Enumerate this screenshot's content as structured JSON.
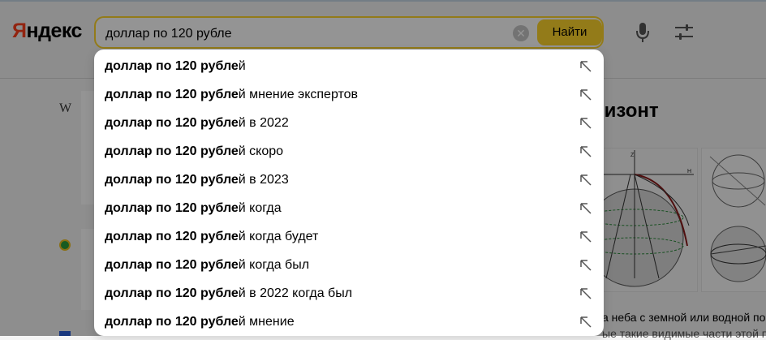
{
  "header": {
    "logo_first": "Я",
    "logo_rest": "ндекс",
    "search_value": "доллар по 120 рубле",
    "find_label": "Найти"
  },
  "background": {
    "wiki_glyph": "W",
    "result_title": "ризонт",
    "snippet_line1": "а неба с земной или водной пове",
    "snippet_line2": "ые такие видимые части этой по"
  },
  "suggest": {
    "items": [
      {
        "bold": "доллар по 120 рубле",
        "rest": "й"
      },
      {
        "bold": "доллар по 120 рубле",
        "rest": "й мнение экспертов"
      },
      {
        "bold": "доллар по 120 рубле",
        "rest": "й в 2022"
      },
      {
        "bold": "доллар по 120 рубле",
        "rest": "й скоро"
      },
      {
        "bold": "доллар по 120 рубле",
        "rest": "й в 2023"
      },
      {
        "bold": "доллар по 120 рубле",
        "rest": "й когда"
      },
      {
        "bold": "доллар по 120 рубле",
        "rest": "й когда будет"
      },
      {
        "bold": "доллар по 120 рубле",
        "rest": "й когда был"
      },
      {
        "bold": "доллар по 120 рубле",
        "rest": "й в 2022 когда был"
      },
      {
        "bold": "доллар по 120 рубле",
        "rest": "й мнение"
      }
    ]
  },
  "icons": {
    "clear": "close-icon",
    "mic": "microphone-icon",
    "filters": "filters-icon",
    "suggest_arrow": "arrow-up-left-icon"
  },
  "colors": {
    "brand_red": "#fc3f1d",
    "accent_yellow": "#fed42b"
  }
}
